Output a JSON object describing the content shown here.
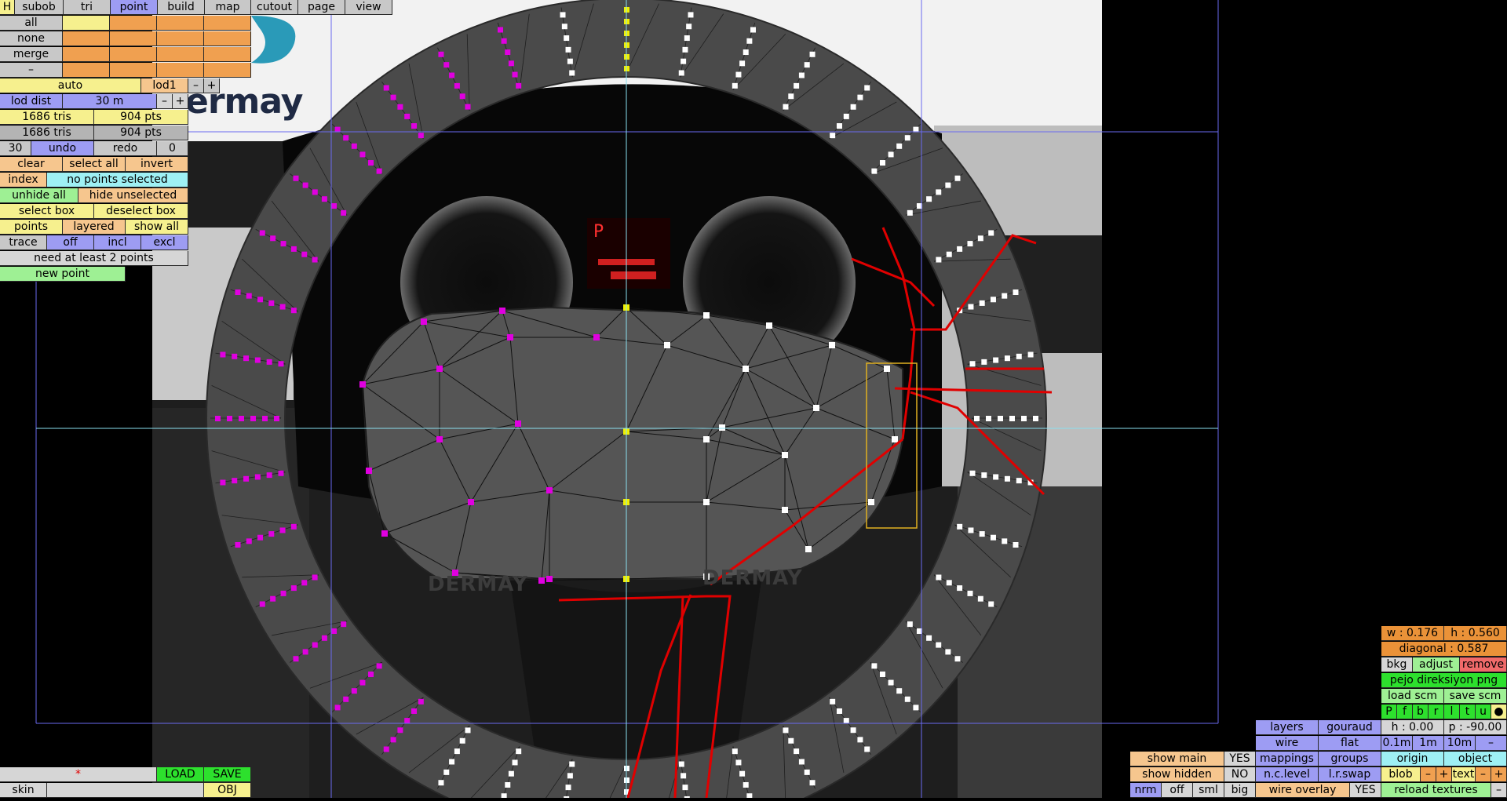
{
  "menu": {
    "h": "H",
    "tabs": [
      "subob",
      "tri",
      "point",
      "build",
      "map",
      "cutout",
      "page",
      "view"
    ],
    "active": "point"
  },
  "selection_rows": [
    "all",
    "none",
    "merge",
    "–"
  ],
  "lod": {
    "auto": "auto",
    "lod1": "lod1",
    "minus": "–",
    "plus": "+",
    "lod_dist": "lod dist",
    "lod_value": "30 m"
  },
  "stats": {
    "tris1": "1686 tris",
    "pts1": "904 pts",
    "tris2": "1686 tris",
    "pts2": "904 pts"
  },
  "history": {
    "count": "30",
    "undo": "undo",
    "redo": "redo",
    "redo_count": "0"
  },
  "select_ops": {
    "clear": "clear",
    "select_all": "select all",
    "invert": "invert",
    "index": "index",
    "no_selection": "no points selected",
    "unhide_all": "unhide all",
    "hide_unselected": "hide unselected",
    "select_box": "select box",
    "deselect_box": "deselect box"
  },
  "display": {
    "points": "points",
    "layered": "layered",
    "show_all": "show all",
    "trace": "trace",
    "off": "off",
    "incl": "incl",
    "excl": "excl"
  },
  "status_msg": "need at least 2 points",
  "new_point": "new point",
  "logo_text": "ermay",
  "watermarks": [
    "DERMAY",
    "DERMAY"
  ],
  "dash_display": "P",
  "bottom_left": {
    "star": "*",
    "load": "LOAD",
    "save": "SAVE",
    "skin": "skin",
    "obj": "OBJ"
  },
  "right_panel": {
    "w": "w : 0.176",
    "h": "h : 0.560",
    "diagonal": "diagonal : 0.587",
    "bkg": "bkg",
    "adjust": "adjust",
    "remove": "remove",
    "image_name": "pejo direksiyon png",
    "load_scm": "load scm",
    "save_scm": "save scm",
    "toggles": [
      "P",
      "f",
      "b",
      "r",
      "l",
      "t",
      "u",
      "●"
    ],
    "layers": "layers",
    "gouraud": "gouraud",
    "h_value": "h : 0.00",
    "p_value": "p : -90.00",
    "wire": "wire",
    "flat": "flat",
    "step1": "0.1m",
    "step2": "1m",
    "step3": "10m",
    "step_minus": "–",
    "show_main": "show main",
    "show_main_val": "YES",
    "mappings": "mappings",
    "groups": "groups",
    "origin": "origin",
    "object": "object",
    "show_hidden": "show hidden",
    "show_hidden_val": "NO",
    "nc_level": "n.c.level",
    "lr_swap": "l.r.swap",
    "blob": "blob",
    "blob_minus": "–",
    "blob_plus": "+",
    "text": "text",
    "text_minus": "–",
    "text_plus": "+",
    "nrm": "nrm",
    "off": "off",
    "sml": "sml",
    "big": "big",
    "wire_overlay": "wire overlay",
    "wire_overlay_val": "YES",
    "reload_textures": "reload textures",
    "reload_minus": "–"
  },
  "colors": {
    "panel_blue": "#9d9cf3",
    "panel_orange": "#f0a050",
    "panel_yellow": "#f6f08e",
    "panel_green": "#2de02d",
    "magenta_point": "#e000e0",
    "yellow_point": "#f0f000",
    "mesh": "#4a4a4a",
    "red_trace": "#e00000"
  }
}
